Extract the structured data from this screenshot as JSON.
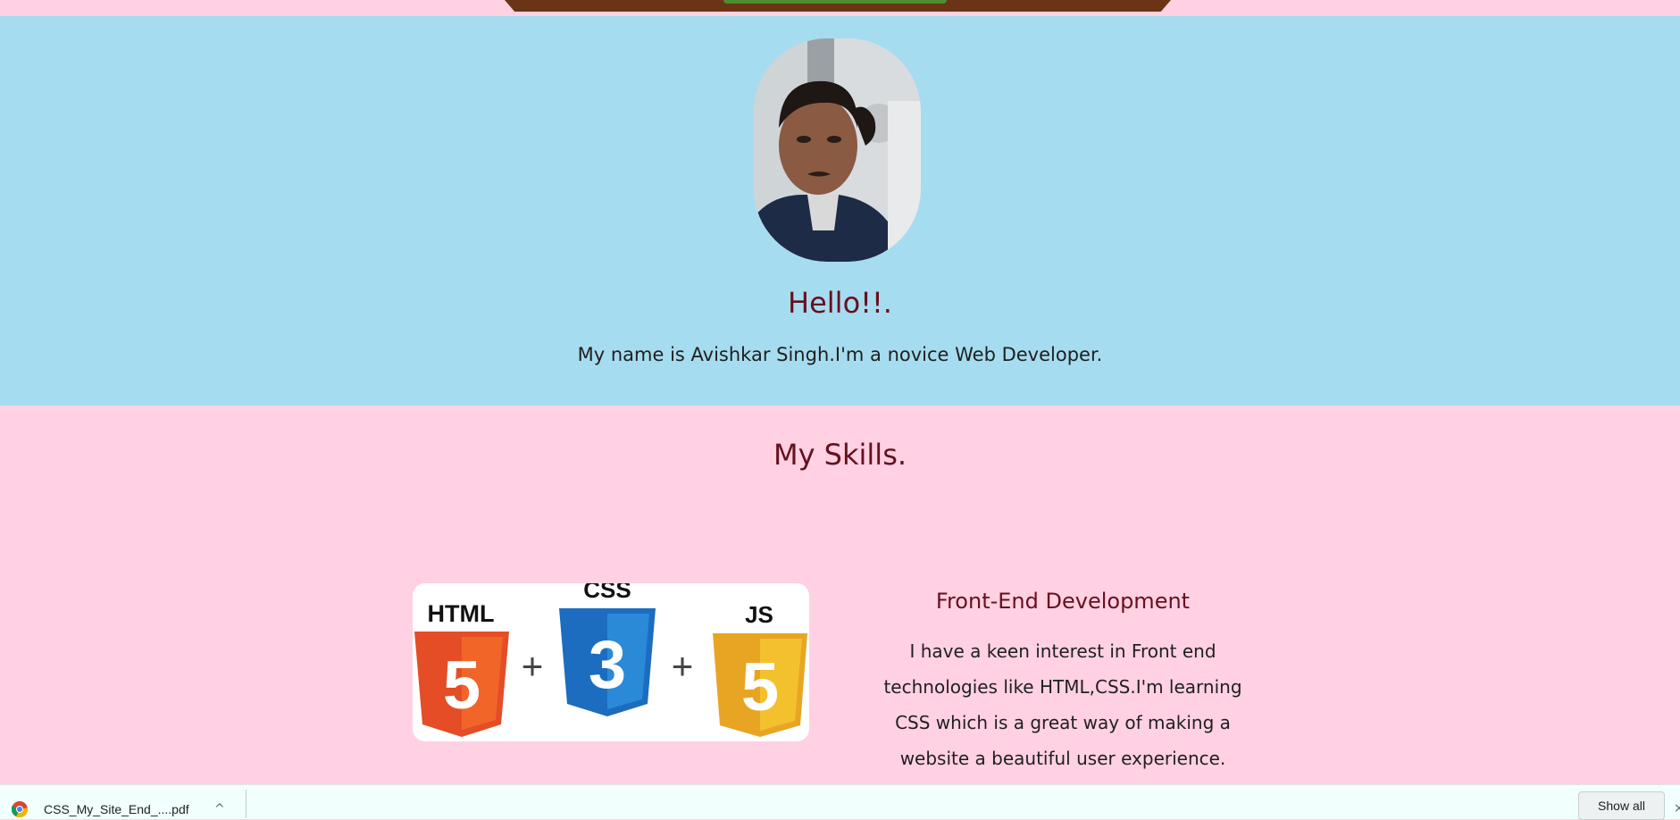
{
  "hero": {
    "mountain_colors": [
      "#6b3416",
      "#4b8f2e"
    ]
  },
  "about": {
    "avatar_alt": "profile photo",
    "heading": "Hello!!.",
    "intro": "My name is Avishkar Singh.I'm a novice Web Developer."
  },
  "skills": {
    "heading": "My Skills.",
    "logos": {
      "html_label": "HTML",
      "html_number": "5",
      "css_label": "CSS",
      "css_number": "3",
      "js_label": "JS",
      "js_number": "5",
      "plus": "+"
    },
    "card_heading": "Front-End Development",
    "card_lines": [
      "I have a keen interest in Front end",
      "technologies like HTML,CSS.I'm learning",
      "CSS which is a great way of making a",
      "website a beautiful user experience."
    ]
  },
  "download_bar": {
    "file_name": "CSS_My_Site_End_....pdf",
    "chevron": "^",
    "show_all": "Show all",
    "close": "×"
  },
  "colors": {
    "pink_bg": "#ffd1e2",
    "blue_bg": "#a6dcef",
    "heading": "#66101f",
    "html_orange": "#e44d26",
    "css_blue": "#1c6cbf",
    "js_yellow": "#e8a524"
  }
}
